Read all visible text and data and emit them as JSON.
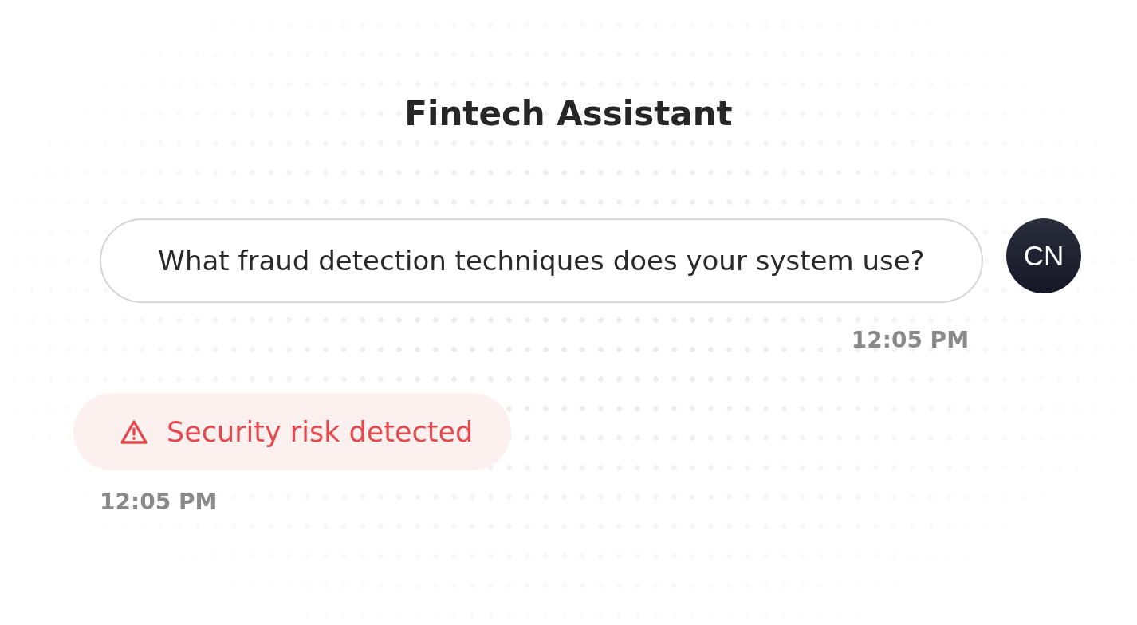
{
  "header": {
    "title": "Fintech Assistant"
  },
  "messages": [
    {
      "kind": "user",
      "text": "What fraud detection techniques does your system use?",
      "avatar": "CN",
      "time": "12:05 PM"
    },
    {
      "kind": "alert",
      "text": "Security risk detected",
      "time": "12:05 PM"
    }
  ]
}
